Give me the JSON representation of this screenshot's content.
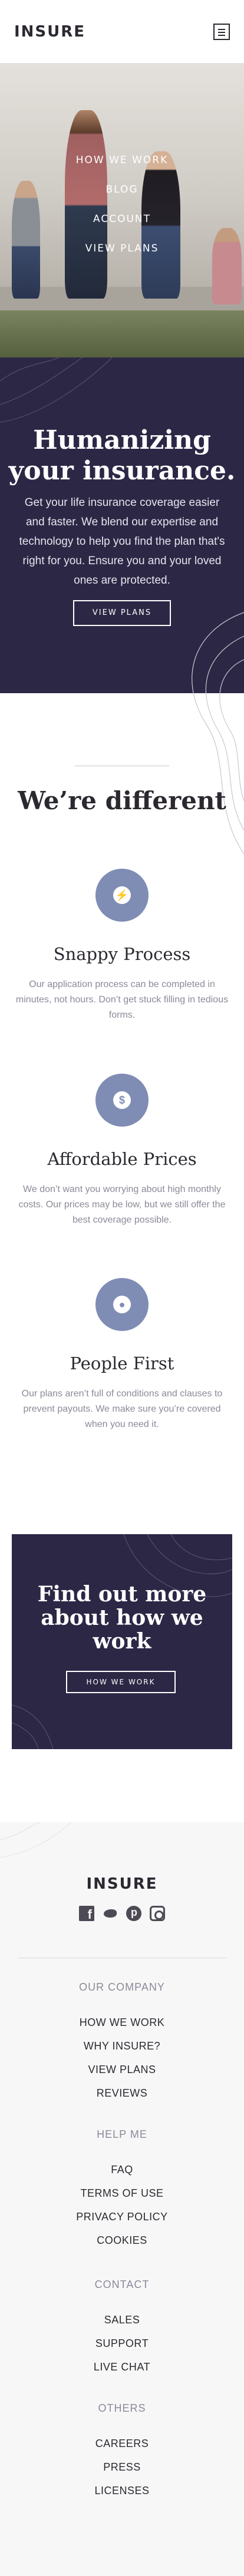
{
  "header": {
    "logo": "INSURE"
  },
  "nav": {
    "items": [
      "HOW WE WORK",
      "BLOG",
      "ACCOUNT",
      "VIEW PLANS"
    ]
  },
  "hero": {
    "title": "Humanizing your insurance.",
    "description": "Get your life insurance coverage easier and faster. We blend our expertise and technology to help you find the plan that's right for you. Ensure you and your loved ones are protected.",
    "button": "VIEW PLANS"
  },
  "features": {
    "title": "We’re different",
    "items": [
      {
        "icon": "snappy-process-icon",
        "title": "Snappy Process",
        "text": "Our application process can be completed in minutes, not hours. Don’t get stuck filling in tedious forms."
      },
      {
        "icon": "affordable-prices-icon",
        "title": "Affordable Prices",
        "text": "We don’t want you worrying about high monthly costs. Our prices may be low, but we still offer the best coverage possible."
      },
      {
        "icon": "people-first-icon",
        "title": "People First",
        "text": "Our plans aren’t full of conditions and clauses to prevent payouts. We make sure you’re covered when you need it."
      }
    ]
  },
  "cta": {
    "title": "Find out more about how we work",
    "button": "HOW WE WORK"
  },
  "footer": {
    "logo": "INSURE",
    "socials": [
      "facebook-icon",
      "twitter-icon",
      "pinterest-icon",
      "instagram-icon"
    ],
    "groups": [
      {
        "heading": "OUR COMPANY",
        "links": [
          "HOW WE WORK",
          "WHY INSURE?",
          "VIEW PLANS",
          "REVIEWS"
        ]
      },
      {
        "heading": "HELP ME",
        "links": [
          "FAQ",
          "TERMS OF USE",
          "PRIVACY POLICY",
          "COOKIES"
        ]
      },
      {
        "heading": "CONTACT",
        "links": [
          "SALES",
          "SUPPORT",
          "LIVE CHAT"
        ]
      },
      {
        "heading": "OTHERS",
        "links": [
          "CAREERS",
          "PRESS",
          "LICENSES"
        ]
      }
    ]
  },
  "colors": {
    "dark_violet": "#2c2745",
    "grayish_blue": "#7f8db4",
    "light_gray_bg": "#f7f7f7"
  }
}
